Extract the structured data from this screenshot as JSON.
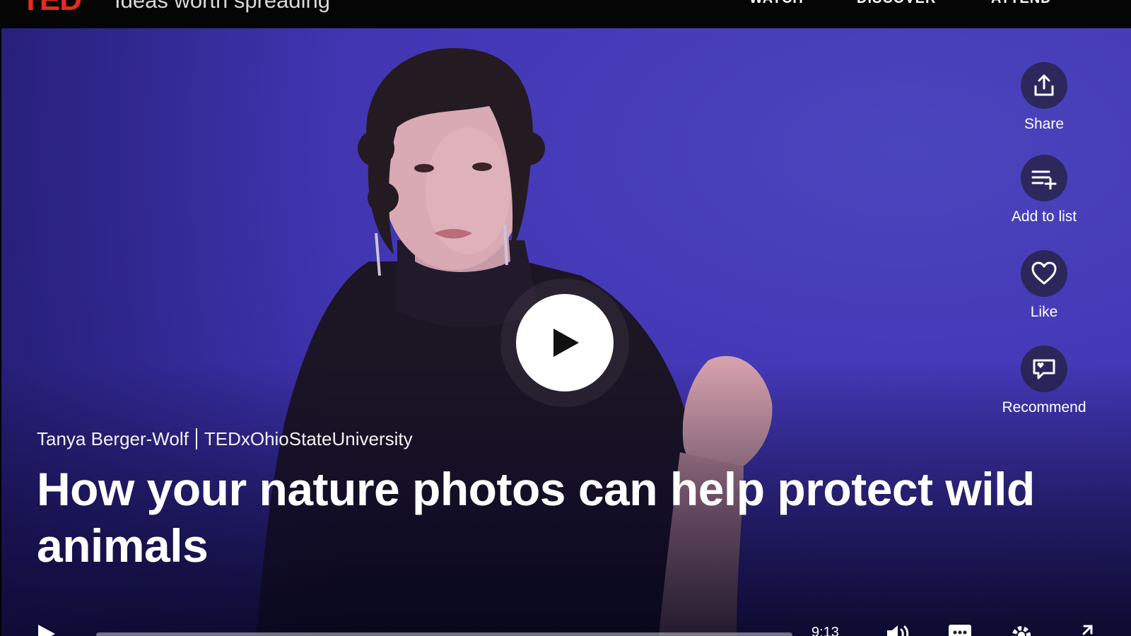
{
  "header": {
    "logo": "TED",
    "tagline": "Ideas worth spreading",
    "nav": [
      "WATCH",
      "DISCOVER",
      "ATTEND"
    ]
  },
  "video": {
    "speaker": "Tanya Berger-Wolf",
    "event": "TEDxOhioStateUniversity",
    "title": "How your nature photos can help protect wild animals",
    "duration": "9:13"
  },
  "actions": [
    {
      "label": "Share",
      "icon": "share-icon"
    },
    {
      "label": "Add to list",
      "icon": "add-to-list-icon"
    },
    {
      "label": "Like",
      "icon": "heart-icon"
    },
    {
      "label": "Recommend",
      "icon": "recommend-icon"
    }
  ],
  "colors": {
    "brand_red": "#e62b1e",
    "stage_blue": "#4438b6"
  }
}
